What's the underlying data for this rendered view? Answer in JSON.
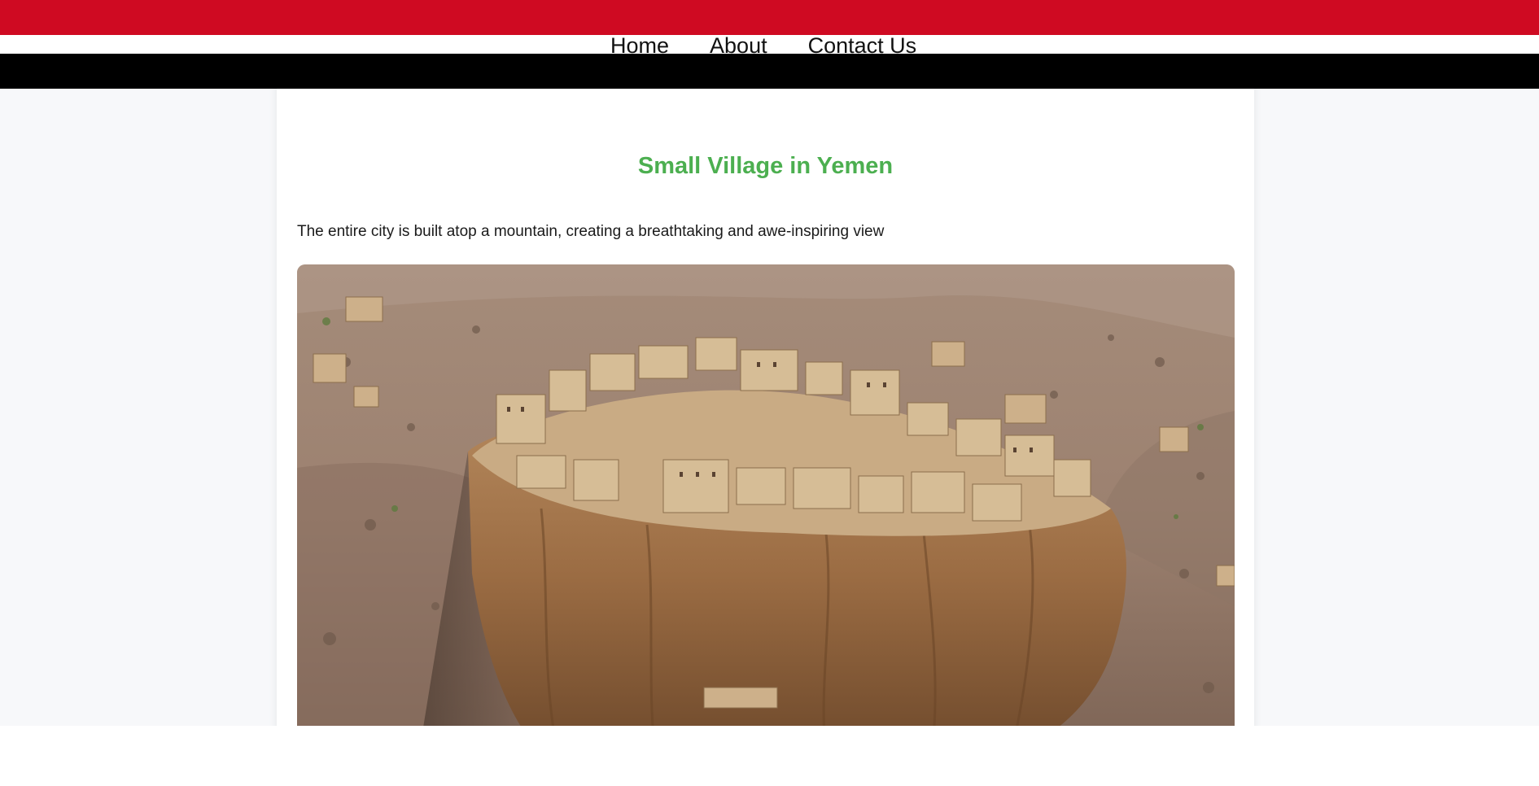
{
  "nav": {
    "items": [
      {
        "label": "Home"
      },
      {
        "label": "About"
      },
      {
        "label": "Contact Us"
      }
    ]
  },
  "article": {
    "title": "Small Village in Yemen",
    "description": "The entire city is built atop a mountain, creating a breathtaking and awe-inspiring view"
  },
  "colors": {
    "top_band": "#cf0a22",
    "middle_band": "#ffffff",
    "bottom_band": "#000000",
    "title": "#4caf50"
  },
  "image": {
    "subject": "aerial photo of a mud-brick village on a flat-topped rock mountain"
  }
}
